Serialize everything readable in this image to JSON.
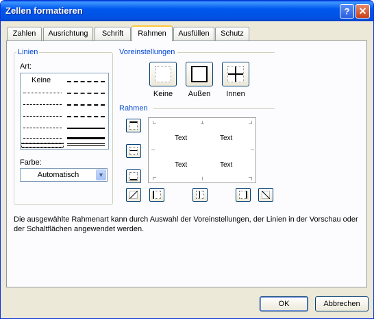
{
  "window": {
    "title": "Zellen formatieren",
    "help_glyph": "?",
    "close_glyph": "✕"
  },
  "tabs": [
    {
      "label": "Zahlen"
    },
    {
      "label": "Ausrichtung"
    },
    {
      "label": "Schrift"
    },
    {
      "label": "Rahmen",
      "active": true
    },
    {
      "label": "Ausfüllen"
    },
    {
      "label": "Schutz"
    }
  ],
  "linien": {
    "group_label": "Linien",
    "art_label": "Art:",
    "none_label": "Keine",
    "farbe_label": "Farbe:",
    "farbe_value": "Automatisch"
  },
  "presets": {
    "group_label": "Voreinstellungen",
    "items": [
      {
        "label": "Keine",
        "icon": "border-none-icon"
      },
      {
        "label": "Außen",
        "icon": "border-outline-icon"
      },
      {
        "label": "Innen",
        "icon": "border-inside-icon"
      }
    ]
  },
  "rahmen": {
    "group_label": "Rahmen",
    "preview_texts": [
      "Text",
      "Text",
      "Text",
      "Text"
    ]
  },
  "description": "Die ausgewählte Rahmenart kann durch Auswahl der Voreinstellungen, der Linien in der Vorschau oder der Schaltflächen angewendet werden.",
  "buttons": {
    "ok": "OK",
    "cancel": "Abbrechen"
  },
  "colors": {
    "titlebar": "#0058ee",
    "group_label": "#0046d5",
    "dialog_bg": "#ece9d8"
  }
}
